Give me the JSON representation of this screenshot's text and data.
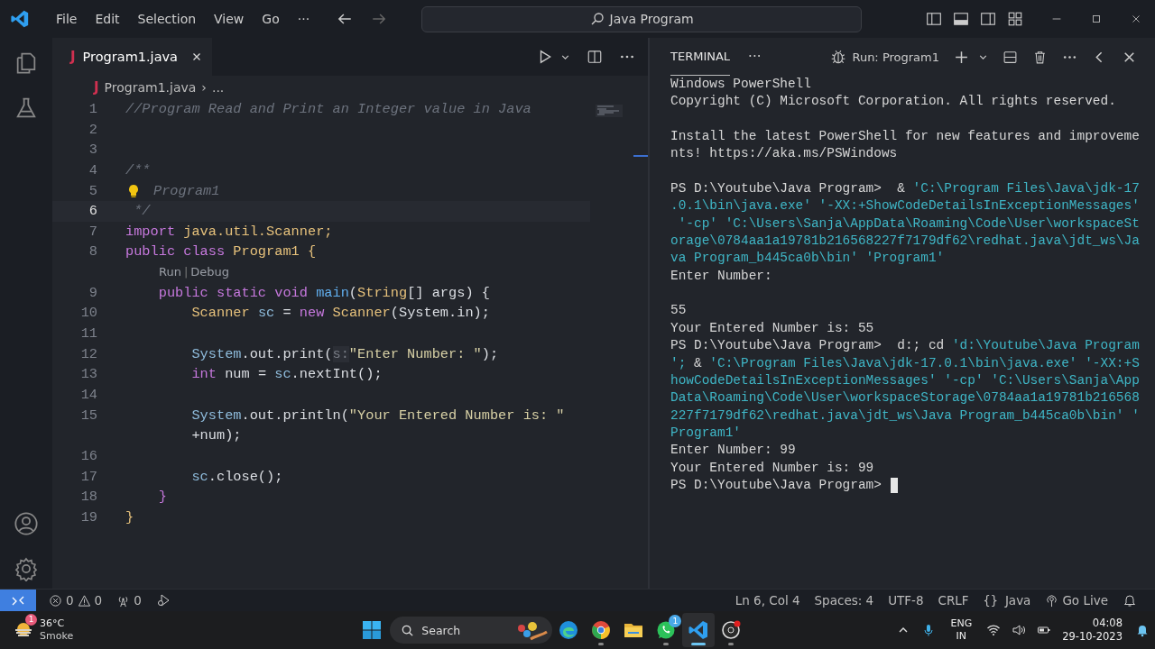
{
  "title_bar": {
    "menu": [
      "File",
      "Edit",
      "Selection",
      "View",
      "Go"
    ],
    "more": "···",
    "search": "Java Program"
  },
  "editor": {
    "tab": {
      "file_icon": "J",
      "label": "Program1.java",
      "selected": true
    },
    "breadcrumb": {
      "file_icon": "J",
      "file": "Program1.java",
      "separator": "›",
      "more": "..."
    },
    "lines": [
      {
        "number": "1",
        "current": false,
        "lightbulb": false,
        "tokens": [
          {
            "t": "//Program Read and Print an Integer value in Java",
            "kind": "comment"
          }
        ]
      },
      {
        "number": "2",
        "current": false,
        "lightbulb": false
      },
      {
        "number": "3",
        "current": false,
        "lightbulb": false
      },
      {
        "number": "4",
        "current": false,
        "lightbulb": false,
        "tokens": [
          {
            "t": "/**",
            "kind": "comment"
          }
        ]
      },
      {
        "number": "5",
        "current": false,
        "lightbulb": true,
        "tokens": [
          {
            "t": "Program1",
            "kind": "comment"
          }
        ]
      },
      {
        "number": "6",
        "current": true,
        "lightbulb": false,
        "tokens": [
          {
            "t": " */",
            "kind": "comment"
          }
        ]
      },
      {
        "number": "7",
        "current": false,
        "lightbulb": false,
        "tokens": [
          {
            "t": "import",
            "kind": "keyword"
          },
          {
            "t": " java.util.Scanner;",
            "kind": "type"
          }
        ]
      },
      {
        "number": "8",
        "current": false,
        "lightbulb": false,
        "tokens": [
          {
            "t": "public class",
            "kind": "keyword"
          },
          {
            "t": " Program1 ",
            "kind": "type"
          },
          {
            "t": "{",
            "kind": "bracket"
          }
        ]
      },
      {
        "number": "9",
        "current": false,
        "lightbulb": false,
        "codelens": {
          "run": "Run",
          "separator": "|",
          "debug": "Debug"
        },
        "tokens": [
          {
            "t": "    public static void",
            "kind": "keyword"
          },
          {
            "t": " main",
            "kind": "func"
          },
          {
            "t": "(",
            "kind": "plain"
          },
          {
            "t": "String",
            "kind": "type"
          },
          {
            "t": "[] args) {",
            "kind": "plain"
          }
        ]
      },
      {
        "number": "10",
        "current": false,
        "lightbulb": false,
        "tokens": [
          {
            "t": "        Scanner",
            "kind": "type"
          },
          {
            "t": " sc",
            "kind": "var"
          },
          {
            "t": " = ",
            "kind": "plain"
          },
          {
            "t": "new",
            "kind": "keyword"
          },
          {
            "t": " Scanner",
            "kind": "type"
          },
          {
            "t": "(System.in);",
            "kind": "plain"
          }
        ]
      },
      {
        "number": "11",
        "current": false,
        "lightbulb": false
      },
      {
        "number": "12",
        "current": false,
        "lightbulb": false,
        "tokens": [
          {
            "t": "        System",
            "kind": "var"
          },
          {
            "t": ".out.print(",
            "kind": "plain"
          },
          {
            "t": "s:",
            "kind": "hint"
          },
          {
            "t": "\"Enter Number: \"",
            "kind": "string"
          },
          {
            "t": ");",
            "kind": "plain"
          }
        ]
      },
      {
        "number": "13",
        "current": false,
        "lightbulb": false,
        "tokens": [
          {
            "t": "        int",
            "kind": "keyword"
          },
          {
            "t": " num = ",
            "kind": "plain"
          },
          {
            "t": "sc",
            "kind": "var"
          },
          {
            "t": ".nextInt();",
            "kind": "plain"
          }
        ]
      },
      {
        "number": "14",
        "current": false,
        "lightbulb": false
      },
      {
        "number": "15",
        "current": false,
        "lightbulb": false,
        "tokens": [
          {
            "t": "        System",
            "kind": "var"
          },
          {
            "t": ".out.println(",
            "kind": "plain"
          },
          {
            "t": "\"Your Entered Number is: \"",
            "kind": "string"
          }
        ],
        "wrap": [
          {
            "t": "        +num);",
            "kind": "plain"
          }
        ]
      },
      {
        "number": "16",
        "current": false,
        "lightbulb": false
      },
      {
        "number": "17",
        "current": false,
        "lightbulb": false,
        "tokens": [
          {
            "t": "        sc",
            "kind": "var"
          },
          {
            "t": ".close();",
            "kind": "plain"
          }
        ]
      },
      {
        "number": "18",
        "current": false,
        "lightbulb": false,
        "tokens": [
          {
            "t": "    }",
            "kind": "bracket2"
          }
        ]
      },
      {
        "number": "19",
        "current": false,
        "lightbulb": false,
        "tokens": [
          {
            "t": "}",
            "kind": "bracket"
          }
        ]
      }
    ]
  },
  "terminal": {
    "tabs": [
      {
        "label": "TERMINAL",
        "selected": true
      }
    ],
    "more": "···",
    "run_label": "Run: Program1",
    "cursor": true,
    "lines": [
      {
        "kind": "text",
        "segs": [
          {
            "t": "Windows PowerShell",
            "kind": "out"
          }
        ]
      },
      {
        "kind": "text",
        "segs": [
          {
            "t": "Copyright (C) Microsoft Corporation. All rights reserved.",
            "kind": "out"
          }
        ]
      },
      {
        "kind": "blank"
      },
      {
        "kind": "text",
        "segs": [
          {
            "t": "Install the latest PowerShell for new features and improveme",
            "kind": "out"
          }
        ]
      },
      {
        "kind": "text",
        "segs": [
          {
            "t": "nts! https://aka.ms/PSWindows",
            "kind": "out"
          }
        ]
      },
      {
        "kind": "blank"
      },
      {
        "kind": "text",
        "segs": [
          {
            "t": "PS D:\\Youtube\\Java Program>  & ",
            "kind": "out"
          },
          {
            "t": "'C:\\Program Files\\Java\\jdk-17",
            "kind": "str"
          }
        ]
      },
      {
        "kind": "text",
        "segs": [
          {
            "t": ".0.1\\bin\\java.exe' '-XX:+ShowCodeDetailsInExceptionMessages'",
            "kind": "str"
          }
        ]
      },
      {
        "kind": "text",
        "segs": [
          {
            "t": " '-cp' 'C:\\Users\\Sanja\\AppData\\Roaming\\Code\\User\\workspaceSt",
            "kind": "str"
          }
        ]
      },
      {
        "kind": "text",
        "segs": [
          {
            "t": "orage\\0784aa1a19781b216568227f7179df62\\redhat.java\\jdt_ws\\Ja",
            "kind": "str"
          }
        ]
      },
      {
        "kind": "text",
        "segs": [
          {
            "t": "va Program_b445ca0b\\bin' 'Program1'",
            "kind": "str"
          }
        ]
      },
      {
        "kind": "text",
        "segs": [
          {
            "t": "Enter Number:",
            "kind": "out"
          }
        ]
      },
      {
        "kind": "blank"
      },
      {
        "kind": "text",
        "segs": [
          {
            "t": "55",
            "kind": "out"
          }
        ]
      },
      {
        "kind": "text",
        "segs": [
          {
            "t": "Your Entered Number is: 55",
            "kind": "out"
          }
        ]
      },
      {
        "kind": "text",
        "segs": [
          {
            "t": "PS D:\\Youtube\\Java Program>  d:; cd ",
            "kind": "out"
          },
          {
            "t": "'d:\\Youtube\\Java Program",
            "kind": "str"
          }
        ]
      },
      {
        "kind": "text",
        "segs": [
          {
            "t": "';",
            "kind": "str"
          },
          {
            "t": " & ",
            "kind": "out"
          },
          {
            "t": "'C:\\Program Files\\Java\\jdk-17.0.1\\bin\\java.exe' '-XX:+S",
            "kind": "str"
          }
        ]
      },
      {
        "kind": "text",
        "segs": [
          {
            "t": "howCodeDetailsInExceptionMessages' '-cp' 'C:\\Users\\Sanja\\App",
            "kind": "str"
          }
        ]
      },
      {
        "kind": "text",
        "segs": [
          {
            "t": "Data\\Roaming\\Code\\User\\workspaceStorage\\0784aa1a19781b216568",
            "kind": "str"
          }
        ]
      },
      {
        "kind": "text",
        "segs": [
          {
            "t": "227f7179df62\\redhat.java\\jdt_ws\\Java Program_b445ca0b\\bin' '",
            "kind": "str"
          }
        ]
      },
      {
        "kind": "text",
        "segs": [
          {
            "t": "Program1'",
            "kind": "str"
          }
        ]
      },
      {
        "kind": "text",
        "segs": [
          {
            "t": "Enter Number: 99",
            "kind": "out"
          }
        ]
      },
      {
        "kind": "text",
        "segs": [
          {
            "t": "Your Entered Number is: 99",
            "kind": "out"
          }
        ]
      },
      {
        "kind": "text",
        "segs": [
          {
            "t": "PS D:\\Youtube\\Java Program> ",
            "kind": "out"
          }
        ]
      }
    ]
  },
  "status_bar": {
    "errors": "0",
    "warnings": "0",
    "ports": "0",
    "items": [
      "Ln 6, Col 4",
      "Spaces: 4",
      "UTF-8",
      "CRLF"
    ],
    "language_glyph": "{}",
    "language": "Java",
    "go_live": "Go Live"
  },
  "taskbar": {
    "weather": {
      "temp": "36°C",
      "condition": "Smoke",
      "badge": "1"
    },
    "search": "Search",
    "apps": [
      {
        "kind": "edge",
        "active": false,
        "running": false
      },
      {
        "kind": "chrome",
        "active": false,
        "running": true
      },
      {
        "kind": "folder",
        "active": false,
        "running": false
      },
      {
        "kind": "chat",
        "active": false,
        "running": true,
        "badge": "1"
      },
      {
        "kind": "vscode",
        "active": true,
        "running": true
      },
      {
        "kind": "recorder",
        "active": false,
        "running": true
      }
    ],
    "language": [
      "ENG",
      "IN"
    ],
    "time": "04:08",
    "date": "29-10-2023"
  }
}
